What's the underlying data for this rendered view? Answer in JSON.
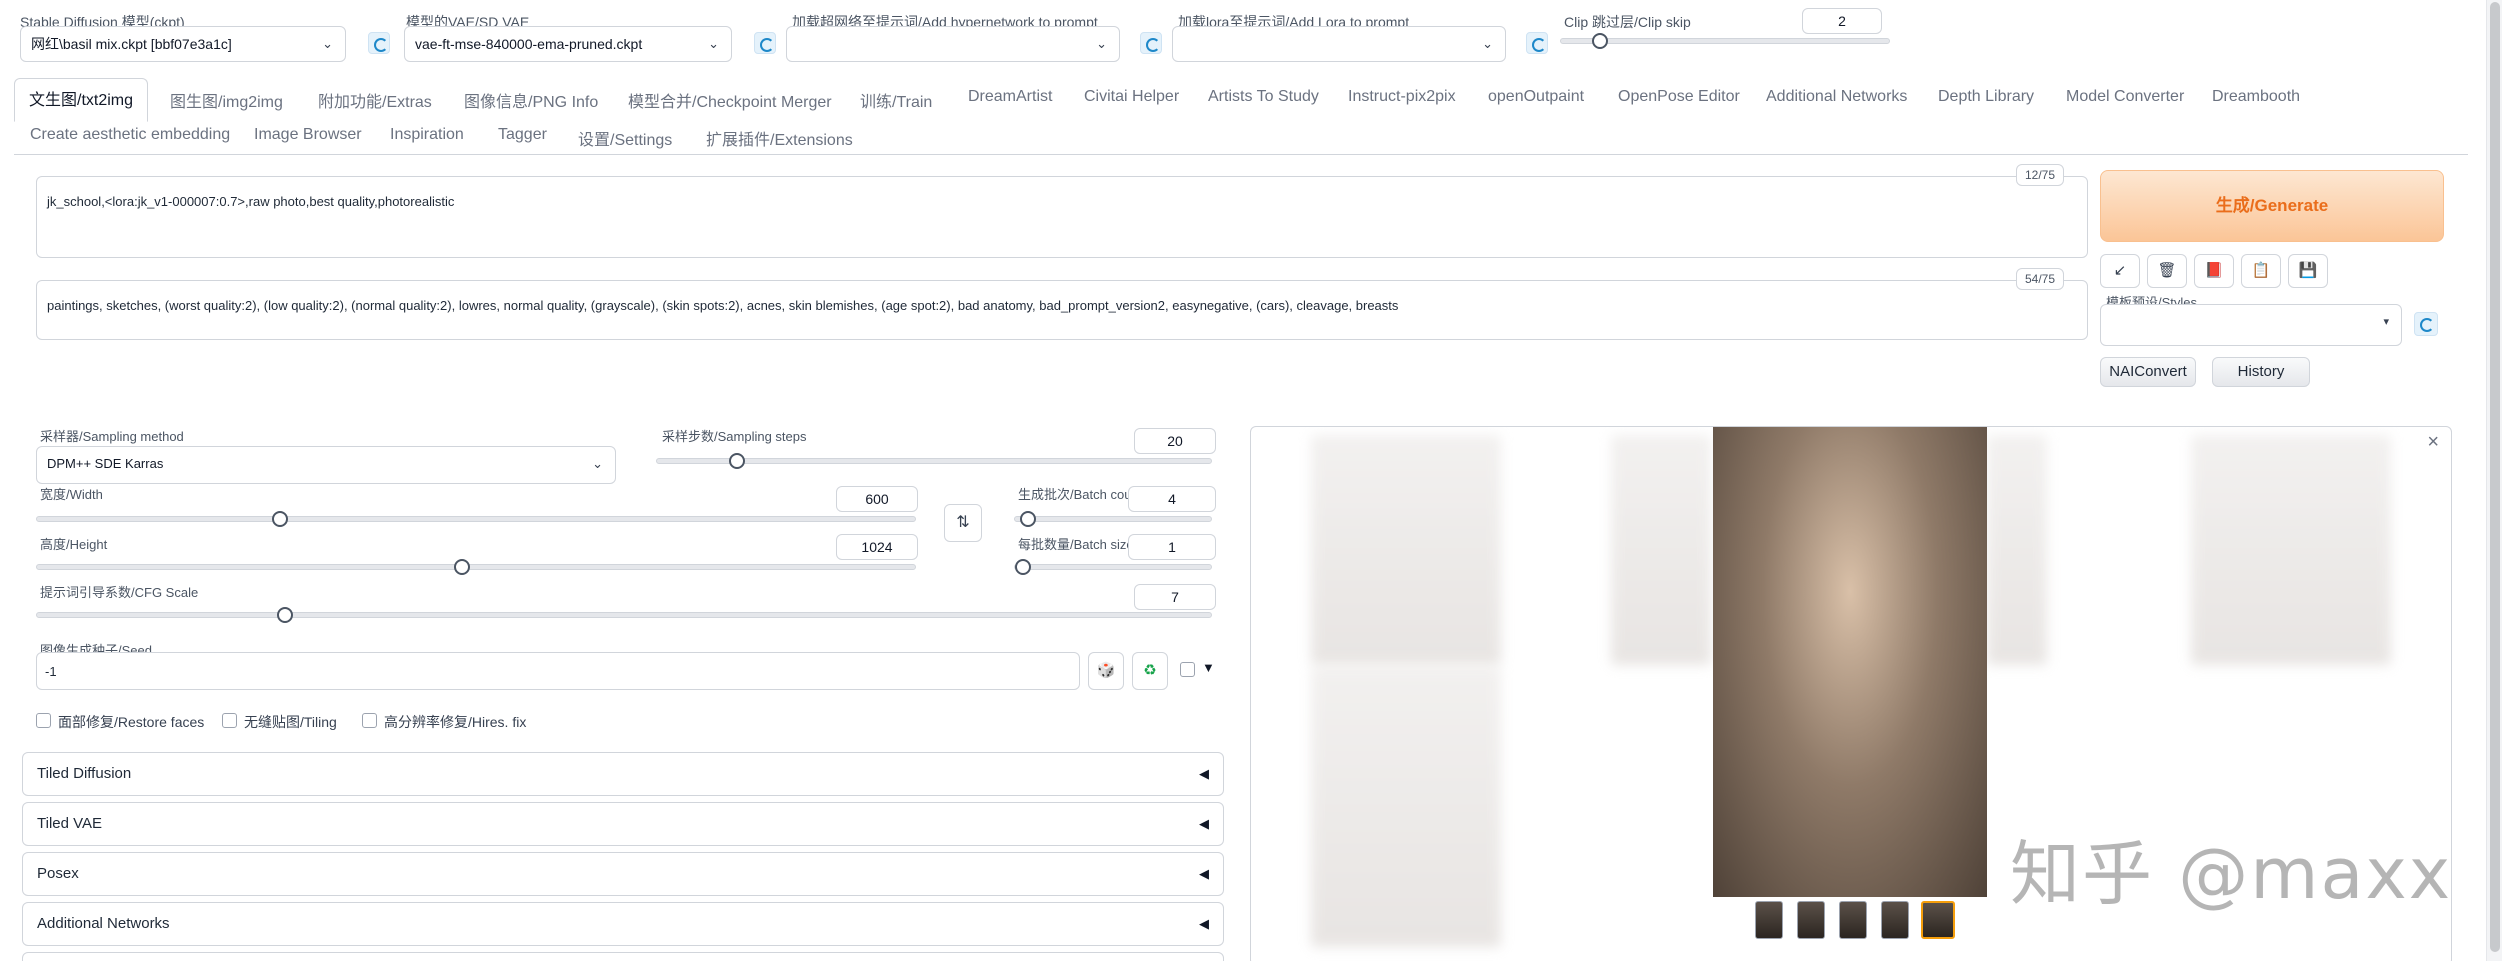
{
  "top": {
    "sd_model": {
      "label": "Stable Diffusion 模型(ckpt)",
      "value": "网红\\basil mix.ckpt [bbf07e3a1c]"
    },
    "vae": {
      "label": "模型的VAE/SD VAE",
      "value": "vae-ft-mse-840000-ema-pruned.ckpt"
    },
    "hypernetwork": {
      "label": "加载超网络至提示词/Add hypernetwork to prompt",
      "value": ""
    },
    "lora": {
      "label": "加载lora至提示词/Add Lora to prompt",
      "value": ""
    },
    "clip_skip": {
      "label": "Clip 跳过层/Clip skip",
      "value": "2",
      "fraction": 0.1
    }
  },
  "tabs_row1": [
    "文生图/txt2img",
    "图生图/img2img",
    "附加功能/Extras",
    "图像信息/PNG Info",
    "模型合并/Checkpoint Merger",
    "训练/Train",
    "DreamArtist",
    "Civitai Helper",
    "Artists To Study",
    "Instruct-pix2pix",
    "openOutpaint",
    "OpenPose Editor",
    "Additional Networks",
    "Depth Library",
    "Model Converter",
    "Dreambooth"
  ],
  "tabs_row2": [
    "Create aesthetic embedding",
    "Image Browser",
    "Inspiration",
    "Tagger",
    "设置/Settings",
    "扩展插件/Extensions"
  ],
  "prompt": {
    "text": "jk_school,<lora:jk_v1-000007:0.7>,raw photo,best quality,photorealistic",
    "counter": "12/75"
  },
  "negative": {
    "text": "paintings, sketches, (worst quality:2), (low quality:2), (normal quality:2), lowres, normal quality, (grayscale), (skin spots:2), acnes, skin blemishes, (age spot:2), bad anatomy, bad_prompt_version2, easynegative, (cars), cleavage, breasts",
    "counter": "54/75"
  },
  "generate": {
    "label_cn": "生成",
    "label_en": "/Generate"
  },
  "tools": {
    "arrow": "↙",
    "trash": "🗑",
    "book": "📕",
    "clipboard": "📋",
    "save": "💾"
  },
  "styles": {
    "label": "模板预设/Styles"
  },
  "buttons": {
    "naiconvert": "NAIConvert",
    "history": "History"
  },
  "sampling": {
    "method_label": "采样器/Sampling method",
    "method_value": "DPM++ SDE Karras",
    "steps_label": "采样步数/Sampling steps",
    "steps_value": "20",
    "steps_fraction": 0.133
  },
  "width": {
    "label": "宽度/Width",
    "value": "600",
    "fraction": 0.273
  },
  "height": {
    "label": "高度/Height",
    "value": "1024",
    "fraction": 0.484
  },
  "batch_count": {
    "label": "生成批次/Batch count",
    "value": "4",
    "fraction": 0.03
  },
  "batch_size": {
    "label": "每批数量/Batch size",
    "value": "1",
    "fraction": 0.0
  },
  "swap_icon": "⇅",
  "cfg": {
    "label": "提示词引导系数/CFG Scale",
    "value": "7",
    "fraction": 0.207
  },
  "seed": {
    "label": "图像生成种子/Seed",
    "value": "-1",
    "dice": "🎲",
    "recycle": "♻",
    "extra_arrow": "▼"
  },
  "options": [
    "面部修复/Restore faces",
    "无缝贴图/Tiling",
    "高分辨率修复/Hires. fix"
  ],
  "accordions": [
    "Tiled Diffusion",
    "Tiled VAE",
    "Posex",
    "Additional Networks"
  ],
  "accordion_arrow": "◀",
  "gallery": {
    "close": "×",
    "watermark": "知乎 @maxx"
  },
  "colors": {
    "accent": "#ea6d1b",
    "generate_bg": "#fbc597",
    "refresh": "#1e88c9"
  }
}
